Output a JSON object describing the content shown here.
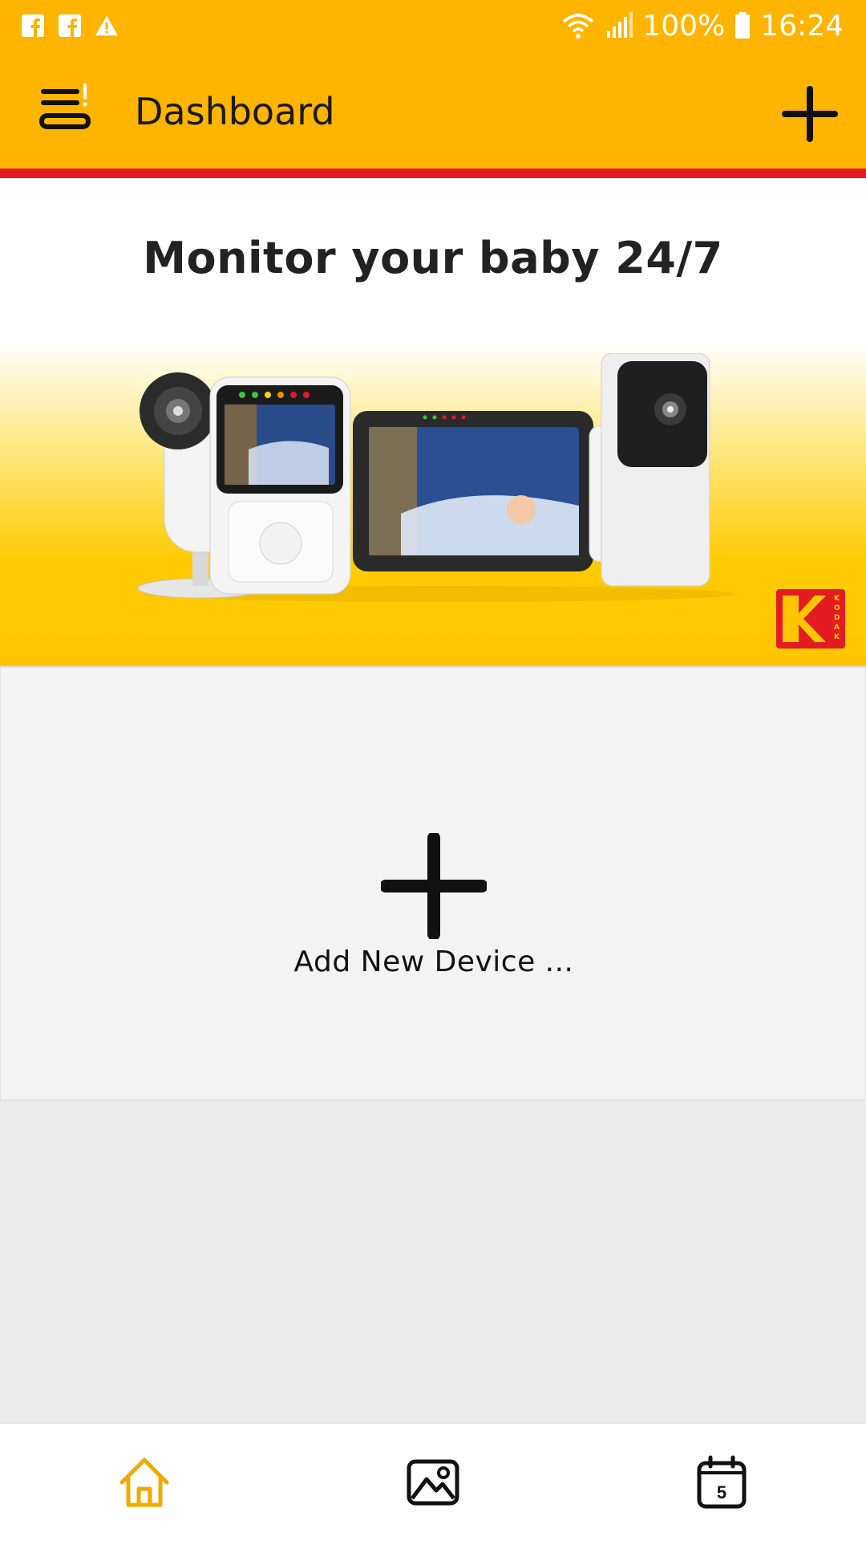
{
  "status_bar": {
    "notifications": [
      "facebook-icon",
      "facebook-icon",
      "warning-icon"
    ],
    "battery": "100%",
    "time": "16:24"
  },
  "app_bar": {
    "title": "Dashboard",
    "menu_icon": "menu-alert-icon",
    "add_icon": "plus-icon"
  },
  "banner": {
    "headline": "Monitor your baby 24/7",
    "logo": "KODAK"
  },
  "add_device": {
    "label": "Add New Device ..."
  },
  "bottom_nav": {
    "items": [
      {
        "icon": "home-icon",
        "active": true
      },
      {
        "icon": "gallery-icon",
        "active": false
      },
      {
        "icon": "calendar-icon",
        "active": false,
        "badge": "5"
      }
    ]
  },
  "colors": {
    "brand_yellow": "#FFB400",
    "accent_red": "#E31B23",
    "active_nav": "#F2A900"
  }
}
